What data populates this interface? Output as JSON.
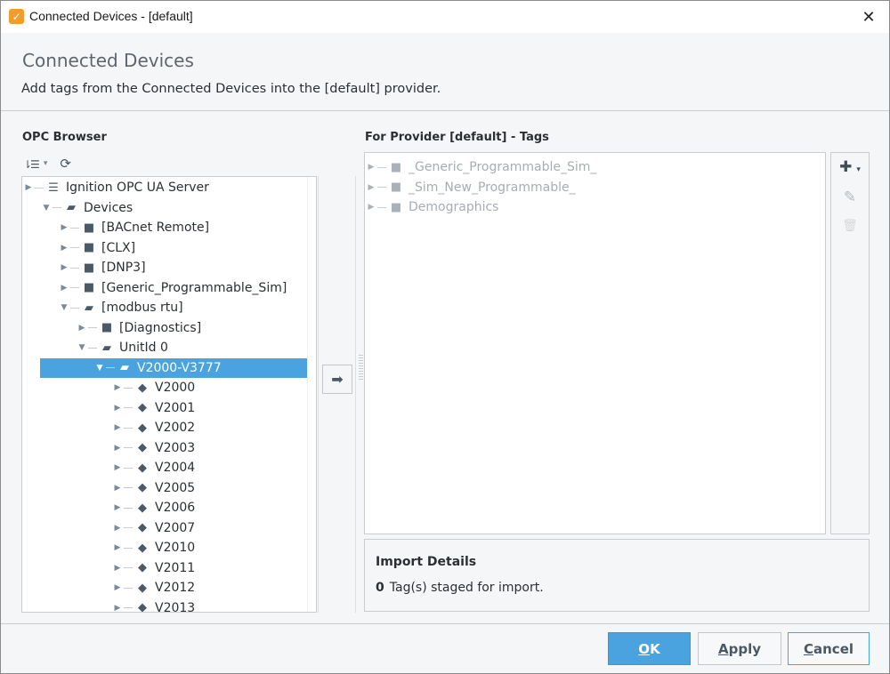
{
  "window": {
    "title": "Connected Devices - [default]",
    "app_icon": "ignition-icon",
    "close_glyph": "✕"
  },
  "header": {
    "title": "Connected Devices",
    "description": "Add tags from the Connected Devices into the [default] provider."
  },
  "opc_browser": {
    "label": "OPC Browser",
    "toolbar": {
      "sort_icon": "sort-icon",
      "sort_glyph": "⇂☰",
      "caret_glyph": "▾",
      "refresh_icon": "refresh-icon",
      "refresh_glyph": "⟳"
    },
    "tree": [
      {
        "label": "Ignition OPC UA Server",
        "depth": 0,
        "icon": "server",
        "expander": "collapsed",
        "selected": false
      },
      {
        "label": "Devices",
        "depth": 1,
        "icon": "folder-open",
        "expander": "expanded",
        "selected": false
      },
      {
        "label": "[BACnet Remote]",
        "depth": 2,
        "icon": "folder",
        "expander": "collapsed",
        "selected": false
      },
      {
        "label": "[CLX]",
        "depth": 2,
        "icon": "folder",
        "expander": "collapsed",
        "selected": false
      },
      {
        "label": "[DNP3]",
        "depth": 2,
        "icon": "folder",
        "expander": "collapsed",
        "selected": false
      },
      {
        "label": "[Generic_Programmable_Sim]",
        "depth": 2,
        "icon": "folder",
        "expander": "collapsed",
        "selected": false
      },
      {
        "label": "[modbus rtu]",
        "depth": 2,
        "icon": "folder-open",
        "expander": "expanded",
        "selected": false
      },
      {
        "label": "[Diagnostics]",
        "depth": 3,
        "icon": "folder",
        "expander": "collapsed",
        "selected": false
      },
      {
        "label": "UnitId 0",
        "depth": 3,
        "icon": "folder-open",
        "expander": "expanded",
        "selected": false
      },
      {
        "label": "V2000-V3777",
        "depth": 4,
        "icon": "folder-open",
        "expander": "expanded",
        "selected": true
      },
      {
        "label": "V2000",
        "depth": 5,
        "icon": "tag",
        "expander": "collapsed",
        "selected": false
      },
      {
        "label": "V2001",
        "depth": 5,
        "icon": "tag",
        "expander": "collapsed",
        "selected": false
      },
      {
        "label": "V2002",
        "depth": 5,
        "icon": "tag",
        "expander": "collapsed",
        "selected": false
      },
      {
        "label": "V2003",
        "depth": 5,
        "icon": "tag",
        "expander": "collapsed",
        "selected": false
      },
      {
        "label": "V2004",
        "depth": 5,
        "icon": "tag",
        "expander": "collapsed",
        "selected": false
      },
      {
        "label": "V2005",
        "depth": 5,
        "icon": "tag",
        "expander": "collapsed",
        "selected": false
      },
      {
        "label": "V2006",
        "depth": 5,
        "icon": "tag",
        "expander": "collapsed",
        "selected": false
      },
      {
        "label": "V2007",
        "depth": 5,
        "icon": "tag",
        "expander": "collapsed",
        "selected": false
      },
      {
        "label": "V2010",
        "depth": 5,
        "icon": "tag",
        "expander": "collapsed",
        "selected": false
      },
      {
        "label": "V2011",
        "depth": 5,
        "icon": "tag",
        "expander": "collapsed",
        "selected": false
      },
      {
        "label": "V2012",
        "depth": 5,
        "icon": "tag",
        "expander": "collapsed",
        "selected": false
      },
      {
        "label": "V2013",
        "depth": 5,
        "icon": "tag",
        "expander": "collapsed",
        "selected": false
      }
    ]
  },
  "transfer": {
    "move_icon": "arrow-right-icon",
    "move_glyph": "➡"
  },
  "tags_panel": {
    "label": "For Provider [default] - Tags",
    "items": [
      {
        "label": "_Generic_Programmable_Sim_",
        "icon": "folder"
      },
      {
        "label": "_Sim_New_Programmable_",
        "icon": "folder"
      },
      {
        "label": "Demographics",
        "icon": "folder"
      }
    ],
    "tools": {
      "add_glyph": "✚",
      "add_caret": "▾",
      "edit_glyph": "✎",
      "delete_glyph": "🗑"
    }
  },
  "import_details": {
    "title": "Import Details",
    "count": "0",
    "status_text": "Tag(s) staged for import."
  },
  "buttons": {
    "ok": {
      "mnemonic": "O",
      "rest": "K"
    },
    "apply": {
      "mnemonic": "A",
      "rest": "pply"
    },
    "cancel": {
      "mnemonic": "C",
      "rest": "ancel"
    }
  },
  "colors": {
    "accent": "#4aa3df",
    "app_icon": "#f39c2c",
    "icon_gray": "#4c5a68",
    "disabled_text": "#a7adb3"
  }
}
